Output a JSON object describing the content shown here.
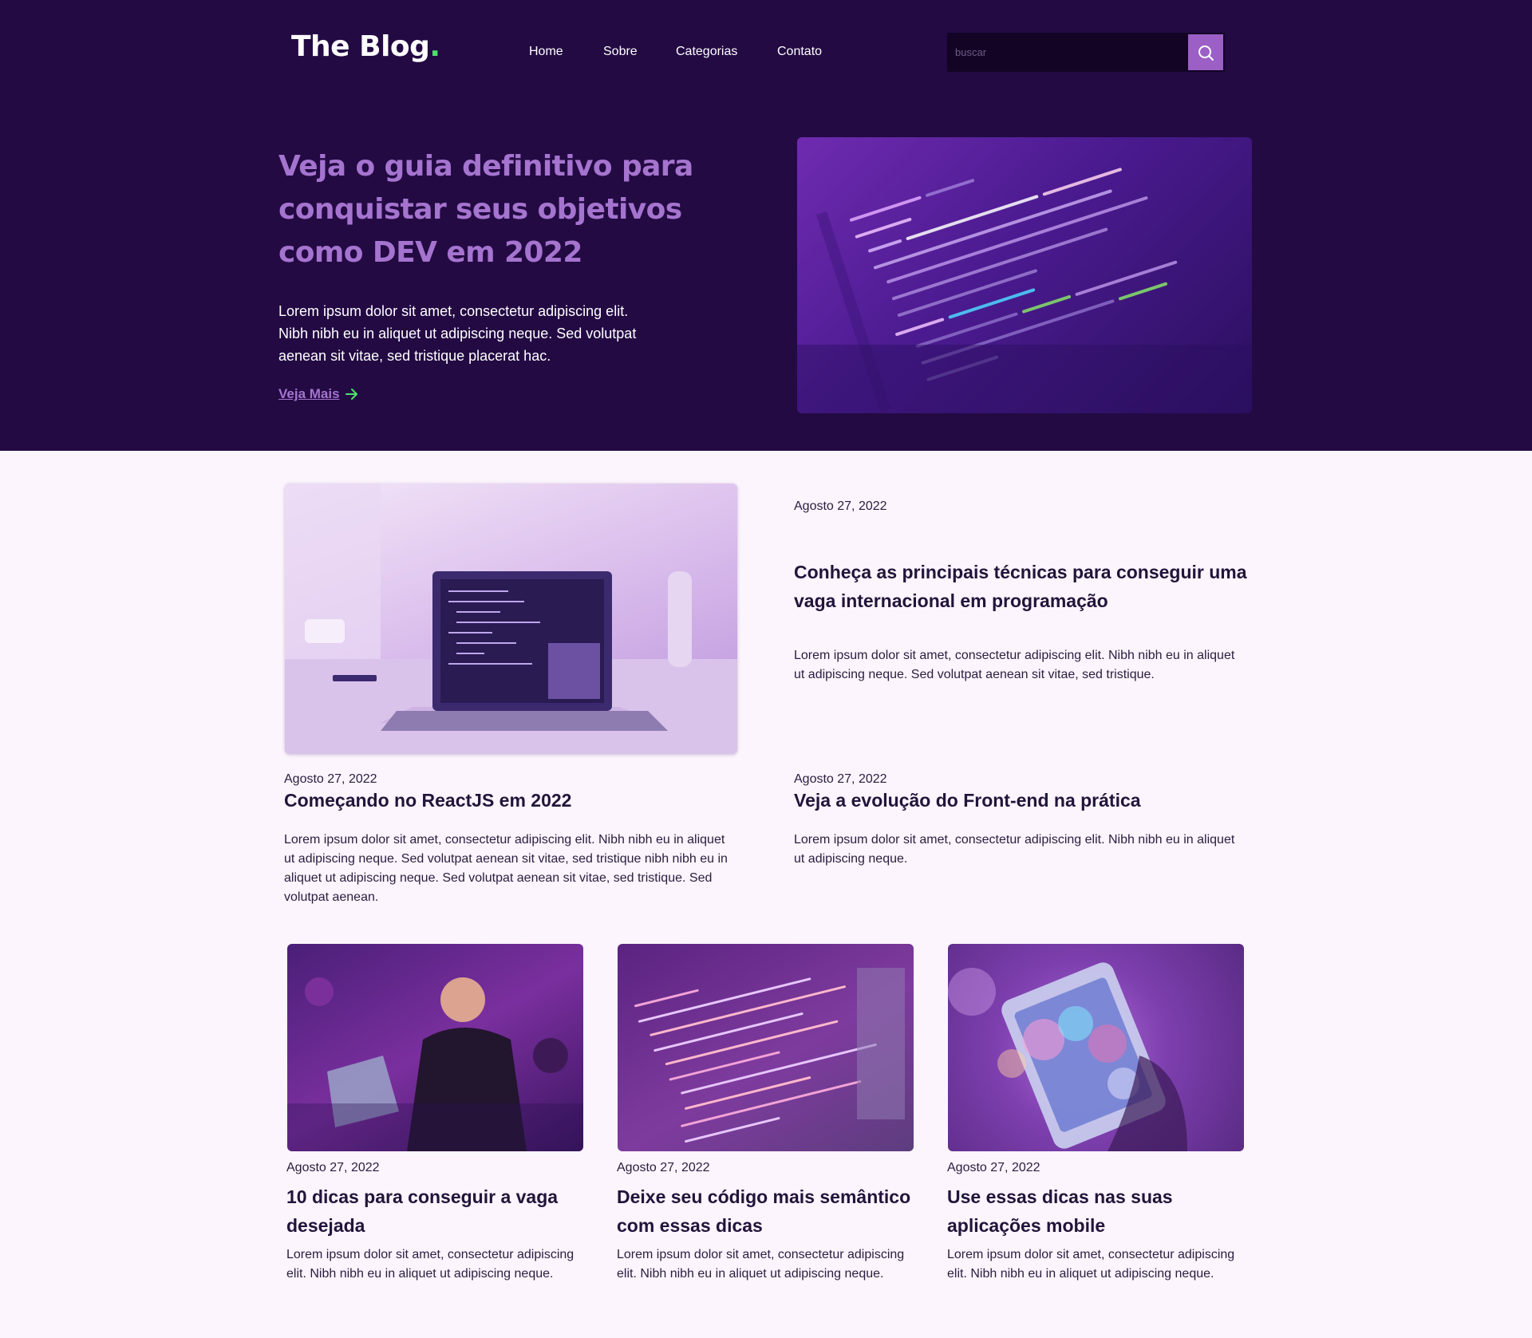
{
  "header": {
    "logo_text": "The Blog",
    "logo_dot": ".",
    "nav": [
      "Home",
      "Sobre",
      "Categorias",
      "Contato"
    ],
    "search_placeholder": "buscar"
  },
  "hero": {
    "title": "Veja o guia definitivo para conquistar seus objetivos como DEV em 2022",
    "text": "Lorem ipsum dolor sit amet, consectetur adipiscing elit. Nibh nibh eu in aliquet ut adipiscing neque. Sed volutpat aenean sit vitae, sed tristique placerat hac.",
    "link_label": "Veja Mais"
  },
  "featured": {
    "date": "Agosto 27, 2022",
    "title": "Começando no ReactJS em 2022",
    "excerpt": "Lorem ipsum dolor sit amet, consectetur adipiscing elit. Nibh nibh eu in aliquet ut adipiscing neque. Sed volutpat aenean sit vitae, sed tristique nibh nibh eu in aliquet ut adipiscing neque. Sed volutpat aenean sit vitae, sed tristique. Sed volutpat aenean."
  },
  "side_posts": [
    {
      "date": "Agosto 27, 2022",
      "title": "Conheça as principais técnicas para conseguir uma vaga internacional em programação",
      "excerpt": "Lorem ipsum dolor sit amet, consectetur adipiscing elit. Nibh nibh eu in aliquet ut adipiscing neque. Sed volutpat aenean sit vitae, sed tristique."
    },
    {
      "date": "Agosto 27, 2022",
      "title": "Veja a evolução do Front-end na prática",
      "excerpt": "Lorem ipsum dolor sit amet, consectetur adipiscing elit. Nibh nibh eu in aliquet ut adipiscing neque."
    }
  ],
  "posts": [
    {
      "date": "Agosto 27, 2022",
      "title": "10 dicas para conseguir a vaga desejada",
      "excerpt": "Lorem ipsum dolor sit amet, consectetur adipiscing elit. Nibh nibh eu in aliquet ut adipiscing neque."
    },
    {
      "date": "Agosto 27, 2022",
      "title": "Deixe seu código mais semântico com essas dicas",
      "excerpt": "Lorem ipsum dolor sit amet, consectetur adipiscing elit. Nibh nibh eu in aliquet ut adipiscing neque."
    },
    {
      "date": "Agosto 27, 2022",
      "title": "Use essas dicas nas suas aplicações mobile",
      "excerpt": "Lorem ipsum dolor sit amet, consectetur adipiscing elit. Nibh nibh eu in aliquet ut adipiscing neque."
    }
  ],
  "colors": {
    "hero_bg": "#230a43",
    "page_bg": "#fcf5fd",
    "accent_purple": "#a574cf",
    "logo_dot_green": "#4ee36a",
    "arrow_green": "#4ee36a"
  }
}
